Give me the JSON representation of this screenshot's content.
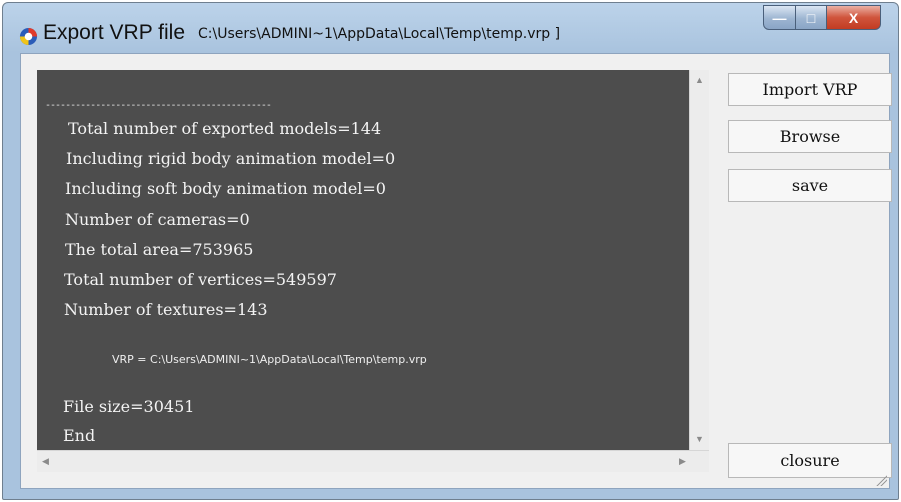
{
  "window": {
    "title": "Export VRP file",
    "path": "C:\\Users\\ADMINI~1\\AppData\\Local\\Temp\\temp.vrp ]",
    "caption": {
      "minimize": "—",
      "maximize": "□",
      "close": "X"
    },
    "colors": {
      "frame": "#a9c3de",
      "close": "#c23c22"
    }
  },
  "output": {
    "divider": "---------------------------------------------",
    "lines": [
      "Total number of exported models=144",
      "Including rigid body animation model=0",
      "Including soft body animation model=0",
      "Number of cameras=0",
      "The total area=753965",
      "Total number of vertices=549597",
      "Number of textures=143",
      "VRP = C:\\Users\\ADMINI~1\\AppData\\Local\\Temp\\temp.vrp",
      "File size=30451",
      "End"
    ],
    "background": "#4d4d4d"
  },
  "buttons": {
    "import": "Import VRP",
    "browse": "Browse",
    "save": "save",
    "closure": "closure"
  },
  "scroll": {
    "up": "▲",
    "down": "▼",
    "left": "◀",
    "right": "▶"
  }
}
